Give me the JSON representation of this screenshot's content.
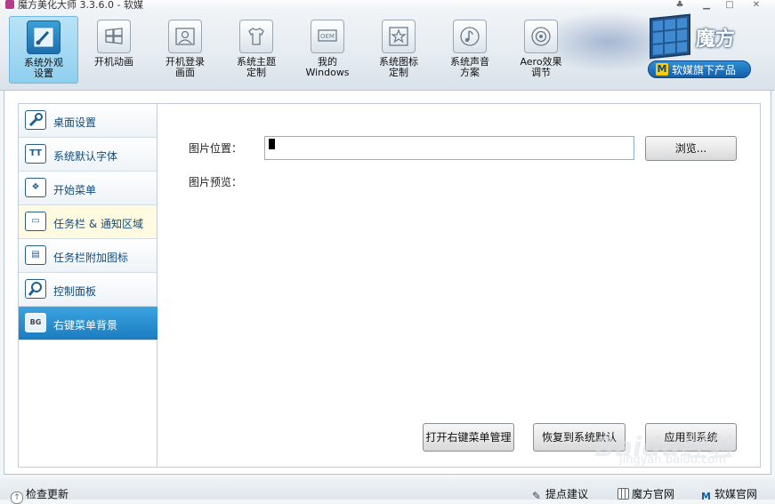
{
  "window": {
    "title": "魔方美化大师 3.3.6.0 - 软媒"
  },
  "toolbar": {
    "items": [
      {
        "label": "系统外观\n设置",
        "icon": "paintbrush-icon"
      },
      {
        "label": "开机动画",
        "icon": "windows-logo-icon"
      },
      {
        "label": "开机登录\n画面",
        "icon": "user-login-icon"
      },
      {
        "label": "系统主题\n定制",
        "icon": "tshirt-icon"
      },
      {
        "label": "我的\nWindows",
        "icon": "oem-icon"
      },
      {
        "label": "系统图标\n定制",
        "icon": "star-icon"
      },
      {
        "label": "系统声音\n方案",
        "icon": "music-note-icon"
      },
      {
        "label": "Aero效果\n调节",
        "icon": "aero-disc-icon"
      }
    ]
  },
  "logo": {
    "brand": "魔方",
    "products_button": "软媒旗下产品",
    "products_icon": "M"
  },
  "sidebar": {
    "items": [
      {
        "label": "桌面设置",
        "icon": "wrench-icon",
        "glyph": "🔧"
      },
      {
        "label": "系统默认字体",
        "icon": "font-icon",
        "glyph": "TT"
      },
      {
        "label": "开始菜单",
        "icon": "start-menu-icon",
        "glyph": "❖"
      },
      {
        "label": "任务栏 & 通知区域",
        "icon": "taskbar-icon",
        "glyph": "▭"
      },
      {
        "label": "任务栏附加图标",
        "icon": "taskbar-icons-icon",
        "glyph": "▤"
      },
      {
        "label": "控制面板",
        "icon": "magnifier-icon",
        "glyph": "⚲"
      },
      {
        "label": "右键菜单背景",
        "icon": "bg-icon",
        "glyph": "BG"
      }
    ]
  },
  "content": {
    "image_location_label": "图片位置：",
    "image_location_value": "",
    "browse_button": "浏览...",
    "preview_label": "图片预览：",
    "open_manager_button": "打开右键菜单管理",
    "restore_button": "恢复到系统默认",
    "apply_button": "应用到系统"
  },
  "statusbar": {
    "check_update": "检查更新",
    "feedback": "提点建议",
    "mofang_site": "魔方官网",
    "ruanmei_site": "软媒官网"
  },
  "watermark": {
    "line1": "Baidu经验",
    "line2": "jingyan.baidu.com"
  }
}
